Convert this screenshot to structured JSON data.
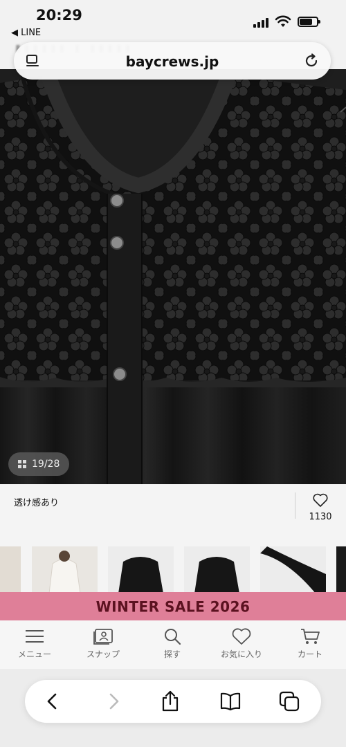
{
  "status_bar": {
    "time": "20:29",
    "back_app": "◀ LINE"
  },
  "browser": {
    "url": "baycrews.jp"
  },
  "product": {
    "image_counter": "19/28",
    "caption": "透け感あり",
    "favorite_count": "1130"
  },
  "banner": {
    "text": "WINTER SALE 2026"
  },
  "tabbar": {
    "items": [
      {
        "label": "メニュー",
        "icon": "menu-icon"
      },
      {
        "label": "スナップ",
        "icon": "snap-icon"
      },
      {
        "label": "探す",
        "icon": "search-icon"
      },
      {
        "label": "お気に入り",
        "icon": "heart-icon"
      },
      {
        "label": "カート",
        "icon": "cart-icon"
      }
    ]
  },
  "toolbar": {
    "icons": [
      "back-icon",
      "forward-icon",
      "share-icon",
      "bookmarks-icon",
      "tabs-icon"
    ]
  }
}
